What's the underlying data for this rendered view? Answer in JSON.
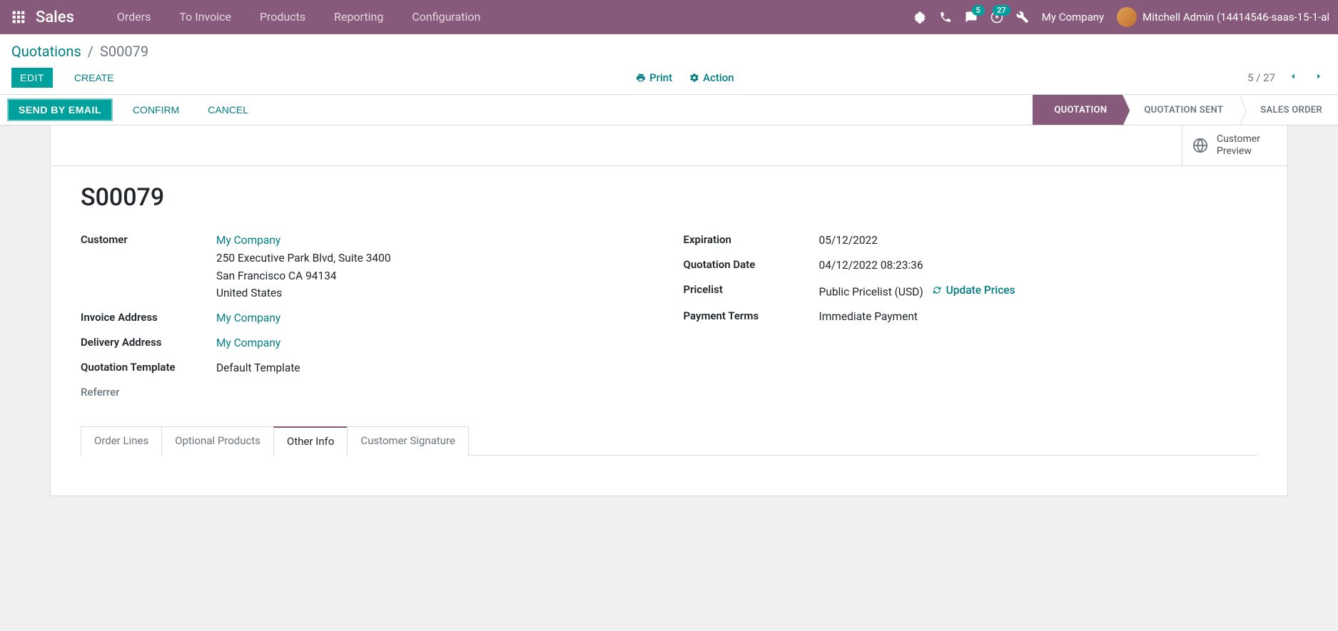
{
  "navbar": {
    "app_name": "Sales",
    "menu": [
      "Orders",
      "To Invoice",
      "Products",
      "Reporting",
      "Configuration"
    ],
    "messages_badge": "5",
    "activities_badge": "27",
    "company_name": "My Company",
    "user_name": "Mitchell Admin (14414546-saas-15-1-al"
  },
  "breadcrumb": {
    "parent": "Quotations",
    "current": "S00079"
  },
  "cp": {
    "edit_label": "EDIT",
    "create_label": "CREATE",
    "print_label": "Print",
    "action_label": "Action",
    "pager": "5 / 27"
  },
  "statusbar": {
    "send_email_label": "SEND BY EMAIL",
    "confirm_label": "CONFIRM",
    "cancel_label": "CANCEL",
    "stages": [
      "QUOTATION",
      "QUOTATION SENT",
      "SALES ORDER"
    ],
    "active_stage": 0
  },
  "stat_button": {
    "label": "Customer Preview"
  },
  "record": {
    "title": "S00079",
    "left": {
      "customer_label": "Customer",
      "customer_name": "My Company",
      "customer_addr1": "250 Executive Park Blvd, Suite 3400",
      "customer_addr2": "San Francisco CA 94134",
      "customer_country": "United States",
      "invoice_addr_label": "Invoice Address",
      "invoice_addr_value": "My Company",
      "delivery_addr_label": "Delivery Address",
      "delivery_addr_value": "My Company",
      "template_label": "Quotation Template",
      "template_value": "Default Template",
      "referrer_label": "Referrer"
    },
    "right": {
      "expiration_label": "Expiration",
      "expiration_value": "05/12/2022",
      "quotation_date_label": "Quotation Date",
      "quotation_date_value": "04/12/2022 08:23:36",
      "pricelist_label": "Pricelist",
      "pricelist_value": "Public Pricelist (USD)",
      "update_prices_label": "Update Prices",
      "payment_terms_label": "Payment Terms",
      "payment_terms_value": "Immediate Payment"
    }
  },
  "tabs": [
    "Order Lines",
    "Optional Products",
    "Other Info",
    "Customer Signature"
  ],
  "active_tab": 2
}
